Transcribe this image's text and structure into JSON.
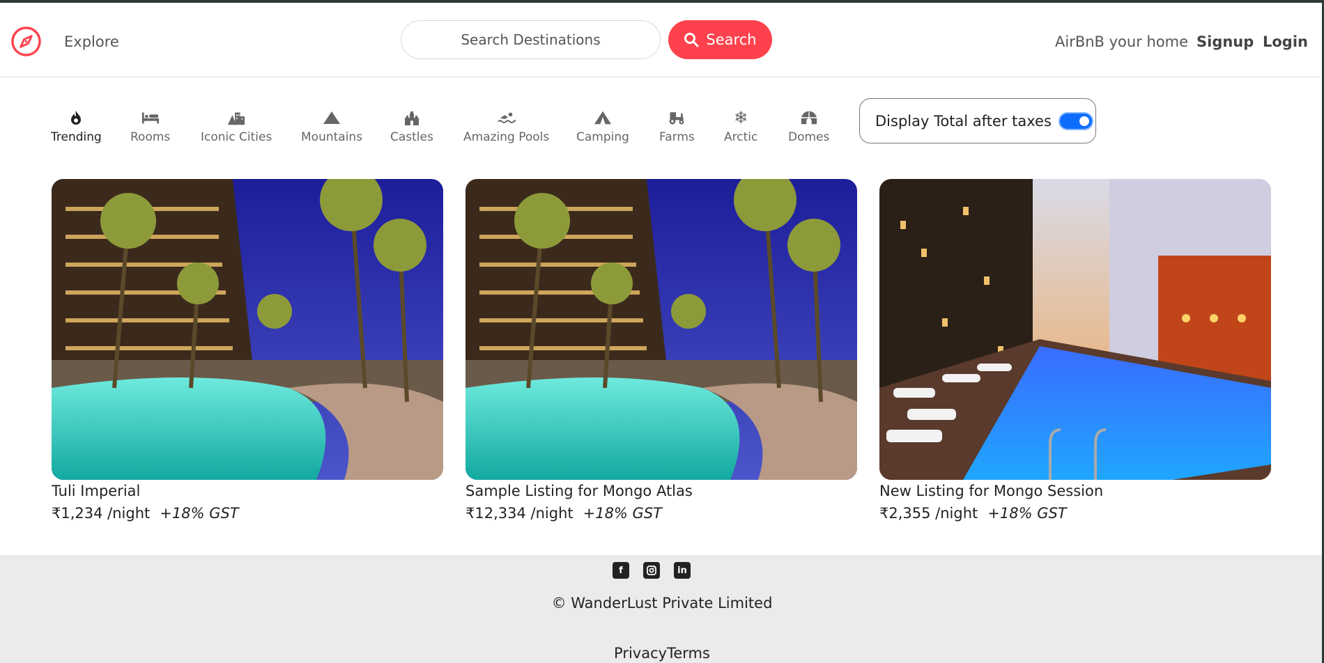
{
  "navbar": {
    "logo_icon": "compass-icon",
    "explore": "Explore",
    "search_placeholder": "Search Destinations",
    "search_label": "Search",
    "airbnb": "AirBnB your home",
    "signup": "Signup",
    "login": "Login",
    "accent": "#fe424d"
  },
  "filters": [
    {
      "label": "Trending",
      "icon": "fire-icon"
    },
    {
      "label": "Rooms",
      "icon": "bed-icon"
    },
    {
      "label": "Iconic Cities",
      "icon": "city-icon"
    },
    {
      "label": "Mountains",
      "icon": "mountain-icon"
    },
    {
      "label": "Castles",
      "icon": "castle-icon"
    },
    {
      "label": "Amazing Pools",
      "icon": "swimmer-icon"
    },
    {
      "label": "Camping",
      "icon": "tent-icon"
    },
    {
      "label": "Farms",
      "icon": "tractor-icon"
    },
    {
      "label": "Arctic",
      "icon": "snowflake-icon"
    },
    {
      "label": "Domes",
      "icon": "igloo-icon"
    }
  ],
  "tax_toggle": {
    "label": "Display Total after taxes",
    "enabled": true
  },
  "listings": [
    {
      "title": "Tuli Imperial",
      "price": "₹1,234 /night",
      "gst": "+18% GST"
    },
    {
      "title": "Sample Listing for Mongo Atlas",
      "price": "₹12,334 /night",
      "gst": "+18% GST"
    },
    {
      "title": "New Listing for Mongo Session",
      "price": "₹2,355 /night",
      "gst": "+18% GST"
    }
  ],
  "footer": {
    "socials": [
      "facebook-icon",
      "instagram-icon",
      "linkedin-icon"
    ],
    "copyright": "© WanderLust Private Limited",
    "privacy": "Privacy",
    "terms": "Terms"
  }
}
